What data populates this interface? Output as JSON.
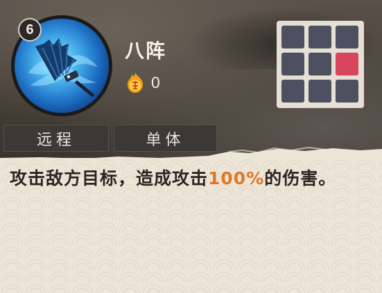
{
  "skill": {
    "level": "6",
    "name": "八阵",
    "cost": "0",
    "cost_icon": "fire-orb-icon",
    "icon": "war-fan-skill-icon"
  },
  "tags": [
    "远程",
    "单体"
  ],
  "description": {
    "part1": "攻击敌方目标，造成攻击",
    "highlight": "100%",
    "part2": "的伤害。"
  },
  "range_grid": {
    "rows": 3,
    "cols": 3,
    "active_cell": [
      1,
      2
    ],
    "colors": {
      "inactive": "#4d5060",
      "active": "#d8465c",
      "frame": "#e6dfd6"
    }
  },
  "colors": {
    "highlight": "#e0782a",
    "text_dark": "#2b2622",
    "tag_bg": "#3b3835"
  }
}
